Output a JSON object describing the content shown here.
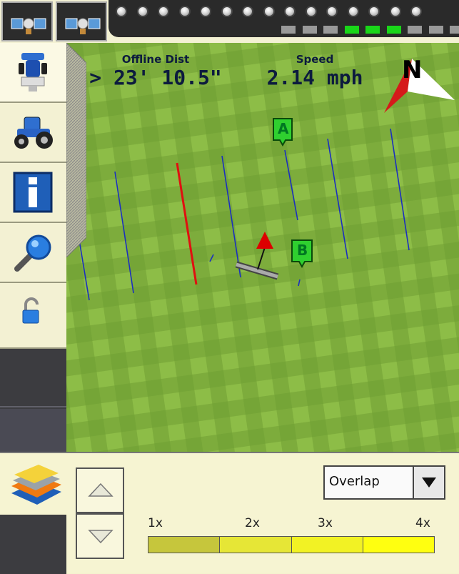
{
  "top_bar": {
    "gps_buttons": [
      {
        "icon": "satellite-icon"
      },
      {
        "icon": "satellite-icon"
      }
    ],
    "led_count": 15,
    "section_indicators": [
      {
        "on": false
      },
      {
        "on": false
      },
      {
        "on": false
      },
      {
        "on": true
      },
      {
        "on": true
      },
      {
        "on": true
      },
      {
        "on": false
      },
      {
        "on": false
      },
      {
        "on": false
      }
    ]
  },
  "sidebar": {
    "items": [
      {
        "name": "implement-view",
        "icon": "implement-icon"
      },
      {
        "name": "vehicle",
        "icon": "tractor-icon"
      },
      {
        "name": "info",
        "icon": "info-icon"
      },
      {
        "name": "zoom",
        "icon": "magnifier-icon"
      },
      {
        "name": "lock",
        "icon": "unlock-icon"
      }
    ]
  },
  "map": {
    "offline_dist_label": "Offline Dist",
    "offline_dist_value": "> 23' 10.5\"",
    "speed_label": "Speed",
    "speed_value": "2.14 mph",
    "north_label": "N",
    "marker_a": "A",
    "marker_b": "B",
    "colors": {
      "field_light": "#8dbd47",
      "field_dark": "#5f8f2c",
      "guide_line": "#1b2fbf",
      "active_line": "#e01010",
      "marker": "#2fd02f"
    }
  },
  "bottom": {
    "layers_icon": "layers-icon",
    "up_icon": "up-arrow-icon",
    "down_icon": "down-arrow-icon",
    "dropdown_value": "Overlap",
    "legend_ticks": [
      "1x",
      "2x",
      "3x",
      "4x"
    ],
    "legend_colors": [
      "#c6c63c",
      "#e6e636",
      "#f2f224",
      "#ffff10"
    ]
  }
}
